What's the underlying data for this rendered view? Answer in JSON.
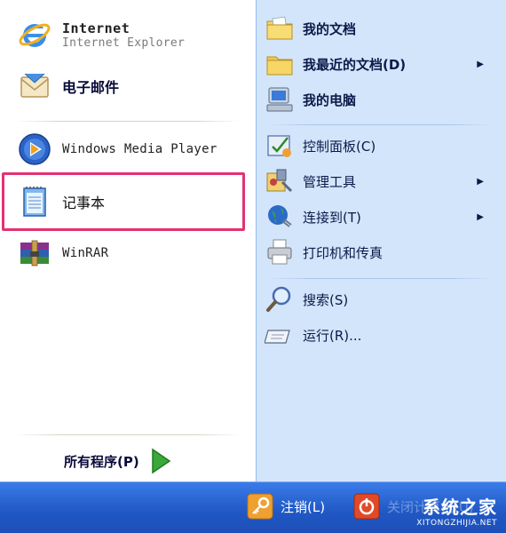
{
  "pinned": {
    "internet": {
      "title": "Internet",
      "subtitle": "Internet Explorer"
    },
    "email": {
      "title": "电子邮件"
    }
  },
  "recent": [
    {
      "label": "Windows Media Player",
      "icon": "media-player-icon"
    },
    {
      "label": "记事本",
      "icon": "notepad-icon"
    },
    {
      "label": "WinRAR",
      "icon": "winrar-icon"
    }
  ],
  "all_programs": {
    "label": "所有程序(P)"
  },
  "right_items": [
    {
      "label": "我的文档",
      "icon": "my-documents-icon",
      "submenu": false
    },
    {
      "label": "我最近的文档(D)",
      "icon": "recent-documents-icon",
      "submenu": true
    },
    {
      "label": "我的电脑",
      "icon": "my-computer-icon",
      "submenu": false
    },
    {
      "label": "控制面板(C)",
      "icon": "control-panel-icon",
      "submenu": false
    },
    {
      "label": "管理工具",
      "icon": "admin-tools-icon",
      "submenu": true
    },
    {
      "label": "连接到(T)",
      "icon": "connect-to-icon",
      "submenu": true
    },
    {
      "label": "打印机和传真",
      "icon": "printers-icon",
      "submenu": false
    },
    {
      "label": "搜索(S)",
      "icon": "search-icon",
      "submenu": false
    },
    {
      "label": "运行(R)...",
      "icon": "run-icon",
      "submenu": false
    }
  ],
  "bottom": {
    "logoff_label": "注销(L)",
    "shutdown_label": "关闭计算机(U)",
    "watermark_main": "系统之家",
    "watermark_sub": "XITONGZHIJIA.NET"
  },
  "colors": {
    "highlight_border": "#e23272",
    "right_panel": "#d3e5fa",
    "bottom_bar": "#2057c4"
  }
}
